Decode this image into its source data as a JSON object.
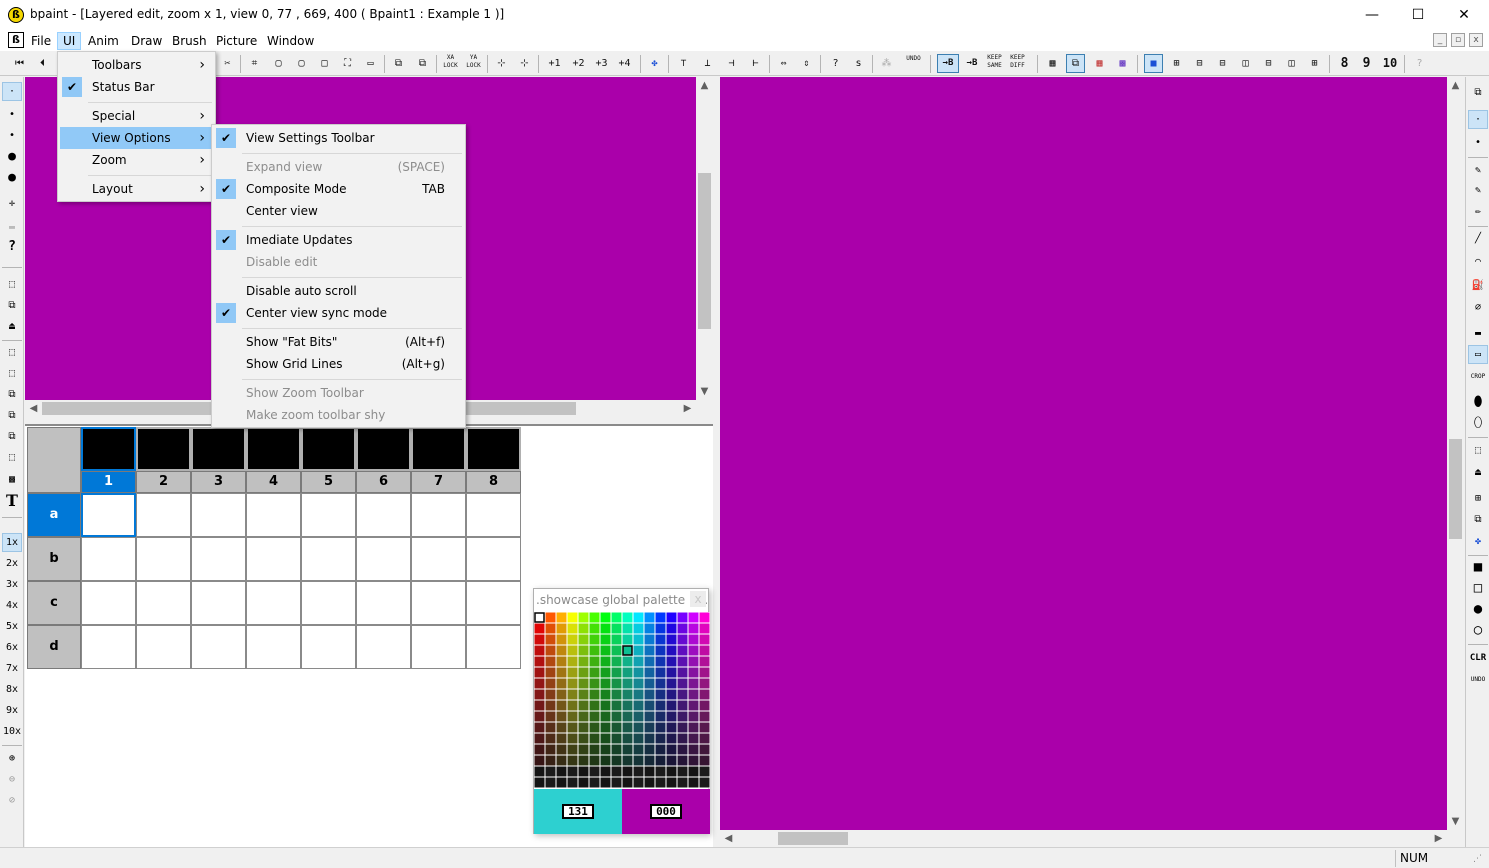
{
  "window": {
    "title": "bpaint - [Layered edit, zoom x 1, view 0, 77 , 669, 400 ( Bpaint1 : Example 1 )]",
    "app_icon_glyph": "ß",
    "minimize": "—",
    "maximize": "☐",
    "close": "✕"
  },
  "menubar": {
    "items": [
      "File",
      "UI",
      "Anim",
      "Draw",
      "Brush",
      "Picture",
      "Window"
    ],
    "active": "UI",
    "mdi_min": "_",
    "mdi_restore": "▫",
    "mdi_close": "x"
  },
  "ui_menu": {
    "items": [
      {
        "label": "Toolbars",
        "checked": false,
        "submenu": true
      },
      {
        "label": "Status Bar",
        "checked": true,
        "submenu": false
      },
      {
        "label": "Special",
        "checked": false,
        "submenu": true
      },
      {
        "label": "View Options",
        "checked": false,
        "submenu": true,
        "highlighted": true
      },
      {
        "label": "Zoom",
        "checked": false,
        "submenu": true
      },
      {
        "label": "Layout",
        "checked": false,
        "submenu": true
      }
    ]
  },
  "view_options_menu": {
    "items": [
      {
        "label": "View Settings Toolbar",
        "shortcut": "",
        "checked": true,
        "disabled": false
      },
      {
        "label": "Expand view",
        "shortcut": "(SPACE)",
        "checked": false,
        "disabled": true
      },
      {
        "label": "Composite Mode",
        "shortcut": "TAB",
        "checked": true,
        "disabled": false
      },
      {
        "label": "Center view",
        "shortcut": "",
        "checked": false,
        "disabled": false
      },
      {
        "label": "Imediate Updates",
        "shortcut": "",
        "checked": true,
        "disabled": false
      },
      {
        "label": "Disable edit",
        "shortcut": "",
        "checked": false,
        "disabled": true
      },
      {
        "label": "Disable auto scroll",
        "shortcut": "",
        "checked": false,
        "disabled": false
      },
      {
        "label": "Center view sync mode",
        "shortcut": "",
        "checked": true,
        "disabled": false
      },
      {
        "label": "Show \"Fat Bits\"",
        "shortcut": "(Alt+f)",
        "checked": false,
        "disabled": false
      },
      {
        "label": "Show Grid Lines",
        "shortcut": "(Alt+g)",
        "checked": false,
        "disabled": false
      },
      {
        "label": "Show Zoom Toolbar",
        "shortcut": "",
        "checked": false,
        "disabled": true
      },
      {
        "label": "Make zoom toolbar shy",
        "shortcut": "",
        "checked": false,
        "disabled": true
      }
    ]
  },
  "frame_grid": {
    "columns": [
      "1",
      "2",
      "3",
      "4",
      "5",
      "6",
      "7",
      "8"
    ],
    "rows": [
      "a",
      "b",
      "c",
      "d"
    ],
    "selected_column": "1",
    "selected_row": "a"
  },
  "palette": {
    "title": ".showcase global palette : ...",
    "close": "x",
    "foreground_index": "131",
    "background_index": "000",
    "foreground_color": "#2dd0d0",
    "background_color": "#aa00aa"
  },
  "zoom_levels": [
    "1x",
    "2x",
    "3x",
    "4x",
    "5x",
    "6x",
    "7x",
    "8x",
    "9x",
    "10x"
  ],
  "toolbar_text_buttons": {
    "xa_lock": "XA LOCK",
    "ya_lock": "YA LOCK",
    "keep_same": "KEEP SAME",
    "keep_diff": "KEEP DIFF",
    "undo": "UNDO",
    "eight": "8",
    "nine": "9",
    "ten": "10",
    "to_b1": "→B",
    "to_b2": "→B",
    "plus1": "+1",
    "plus2": "+2",
    "plus3": "+3",
    "plus4": "+4"
  },
  "right_tools": {
    "clr": "CLR",
    "undo": "UNDO",
    "crop": "CROP"
  },
  "left_tools": {
    "text_tool": "T",
    "help": "?"
  },
  "statusbar": {
    "num": "NUM"
  },
  "colors": {
    "canvas": "#aa00aa",
    "selection": "#0078d7",
    "menu_highlight": "#91c9f7"
  }
}
